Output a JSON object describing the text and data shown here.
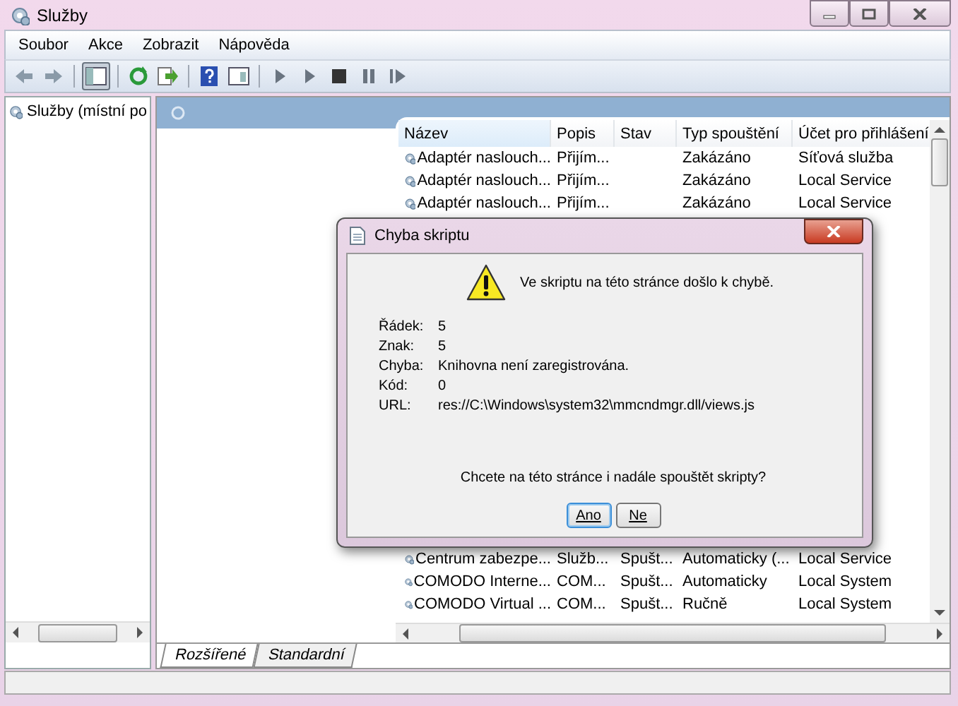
{
  "window": {
    "title": "Služby"
  },
  "menu": [
    "Soubor",
    "Akce",
    "Zobrazit",
    "Nápověda"
  ],
  "tree": {
    "items": [
      {
        "label": "Služby (místní po",
        "selected": false
      }
    ]
  },
  "services_list": {
    "columns": [
      "Název",
      "Popis",
      "Stav",
      "Typ spouštění",
      "Účet pro přihlášení"
    ],
    "rows_top": [
      {
        "name": "Adaptér naslouch...",
        "description": "Přijím...",
        "startup": "Zakázáno",
        "account": "Síťová služba"
      },
      {
        "name": "Adaptér naslouch...",
        "description": "Přijím...",
        "startup": "Zakázáno",
        "account": "Local Service"
      },
      {
        "name": "Adaptér naslouch...",
        "description": "Přijím...",
        "startup": "Zakázáno",
        "account": "Local Service"
      }
    ],
    "rows_bottom": [
      {
        "name": "Centrum zabezpe...",
        "description": "Služb...",
        "status": "Spušt...",
        "startup": "Automaticky (...",
        "account": "Local Service"
      },
      {
        "name": "COMODO Interne...",
        "description": "COM...",
        "status": "Spušt...",
        "startup": "Automaticky",
        "account": "Local System"
      },
      {
        "name": "COMODO Virtual ...",
        "description": "COM...",
        "status": "Spušt...",
        "startup": "Ručně",
        "account": "Local System"
      }
    ]
  },
  "tabs": [
    {
      "label": "Rozšířené",
      "selected": true
    },
    {
      "label": "Standardní",
      "selected": false
    }
  ],
  "dialog": {
    "title": "Chyba skriptu",
    "message": "Ve skriptu na této stránce došlo k chybě.",
    "details": [
      {
        "label": "Řádek:",
        "value": "5"
      },
      {
        "label": "Znak:",
        "value": "5"
      },
      {
        "label": "Chyba:",
        "value": "Knihovna není zaregistrována."
      },
      {
        "label": "Kód:",
        "value": "0"
      },
      {
        "label": "URL:",
        "value": "res://C:\\Windows\\system32\\mmcndmgr.dll/views.js"
      }
    ],
    "question": "Chcete na této stránce i nadále spouštět skripty?",
    "buttons": [
      {
        "label": "Ano",
        "default": true
      },
      {
        "label": "Ne",
        "default": false
      }
    ]
  }
}
